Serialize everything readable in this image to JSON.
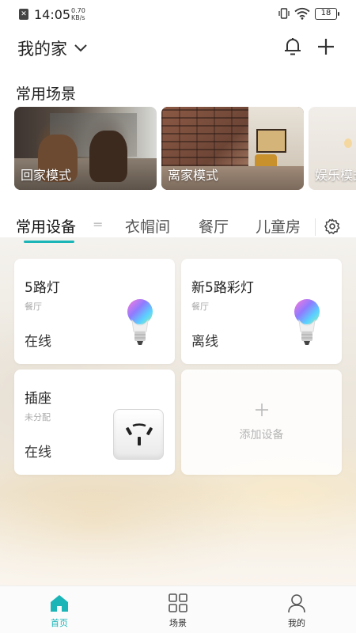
{
  "status_bar": {
    "time": "14:05",
    "net_speed_value": "0.70",
    "net_speed_unit": "KB/s",
    "battery": "18"
  },
  "header": {
    "home_name": "我的家",
    "icons": [
      "bell-icon",
      "plus-icon"
    ]
  },
  "scenes": {
    "title": "常用场景",
    "items": [
      {
        "label": "回家模式"
      },
      {
        "label": "离家模式"
      },
      {
        "label": "娱乐模式"
      }
    ]
  },
  "tabs": {
    "items": [
      {
        "label": "常用设备",
        "active": true
      },
      {
        "label": "衣帽间",
        "active": false
      },
      {
        "label": "餐厅",
        "active": false
      },
      {
        "label": "儿童房",
        "active": false
      }
    ],
    "accent_color": "#1bb5b8"
  },
  "devices": [
    {
      "name": "5路灯",
      "room": "餐厅",
      "state": "在线",
      "icon": "rgb-bulb-icon"
    },
    {
      "name": "新5路彩灯",
      "room": "餐厅",
      "state": "离线",
      "icon": "rgb-bulb-icon"
    },
    {
      "name": "插座",
      "room": "未分配",
      "state": "在线",
      "icon": "socket-icon"
    }
  ],
  "add_device": {
    "label": "添加设备"
  },
  "bottom_nav": {
    "items": [
      {
        "label": "首页",
        "icon": "home-icon",
        "active": true
      },
      {
        "label": "场景",
        "icon": "grid-icon",
        "active": false
      },
      {
        "label": "我的",
        "icon": "user-icon",
        "active": false
      }
    ]
  }
}
